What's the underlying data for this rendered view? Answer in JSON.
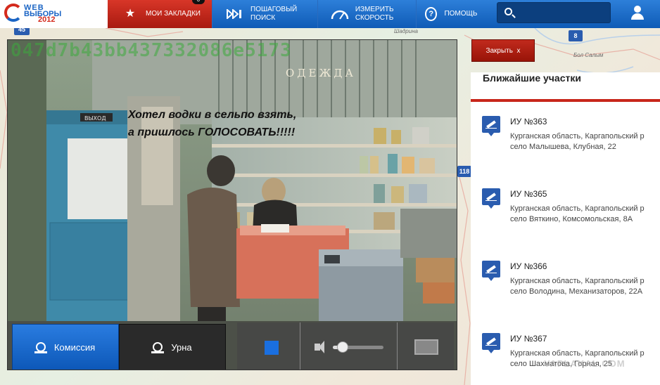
{
  "logo": {
    "word1": "WEB",
    "word2": "ВЫБОРЫ",
    "year": "2012"
  },
  "nav": {
    "bookmarks": {
      "label": "МОИ ЗАКЛАДКИ",
      "badge": "0",
      "icon": "star-icon"
    },
    "step_search": {
      "label": "ПОШАГОВЫЙ ПОИСК",
      "icon": "step-forward-icon"
    },
    "speed": {
      "label": "ИЗМЕРИТЬ СКОРОСТЬ",
      "icon": "speedometer-icon"
    },
    "help": {
      "label": "ПОМОЩЬ",
      "icon": "question-icon"
    }
  },
  "search": {
    "value": "",
    "placeholder": ""
  },
  "map": {
    "labels": [
      "Шадрина",
      "Бол Салым"
    ],
    "pins": [
      "8",
      "118",
      "45"
    ]
  },
  "player": {
    "overlay_id": "047d7b43bb437332086e5173",
    "caption_line1": "Хотел водки в сельпо взять,",
    "caption_line2": "а пришлось ГОЛОСОВАТЬ!!!!!",
    "scene_sign": "ОДЕЖДА",
    "exit_sign": "ВЫХОД",
    "tabs": [
      {
        "label": "Комиссия",
        "active": true
      },
      {
        "label": "Урна",
        "active": false
      }
    ],
    "volume_level": 0.2
  },
  "close_button": {
    "label": "Закрыть",
    "x": "x"
  },
  "side_panel": {
    "title": "Ближайшие участки",
    "stations": [
      {
        "name": "ИУ №363",
        "address_line1": "Курганская область, Каргапольский р",
        "address_line2": "село Малышева, Клубная, 22"
      },
      {
        "name": "ИУ №365",
        "address_line1": "Курганская область, Каргапольский р",
        "address_line2": "село Вяткино, Комсомольская, 8А"
      },
      {
        "name": "ИУ №366",
        "address_line1": "Курганская область, Каргапольский р",
        "address_line2": "село Володина, Механизаторов, 22А"
      },
      {
        "name": "ИУ №367",
        "address_line1": "Курганская область, Каргапольский р",
        "address_line2": "село Шахматова, Горная, 25"
      }
    ]
  },
  "watermark": "YAPLAKAL.COM",
  "colors": {
    "brand_blue": "#0f5bb6",
    "brand_red": "#c12a1d",
    "stop_blue": "#1a6fe0"
  }
}
